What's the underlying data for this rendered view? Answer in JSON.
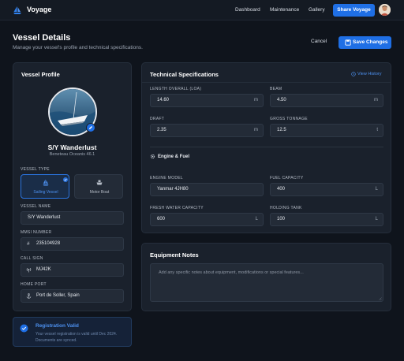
{
  "header": {
    "brand": "Voyage",
    "nav": [
      "Dashboard",
      "Maintenance",
      "Gallery"
    ],
    "share_label": "Share Voyage"
  },
  "page": {
    "title": "Vessel Details",
    "subtitle": "Manage your vessel's profile and technical specifications.",
    "cancel_label": "Cancel",
    "save_label": "Save Changes"
  },
  "profile": {
    "card_title": "Vessel Profile",
    "name": "S/Y Wanderlust",
    "model": "Beneteau Oceanis 46.1",
    "vessel_type_label": "VESSEL TYPE",
    "types": [
      {
        "label": "Sailing Vessel",
        "selected": true
      },
      {
        "label": "Motor Boat",
        "selected": false
      }
    ],
    "vessel_name_label": "VESSEL NAME",
    "vessel_name_value": "S/Y Wanderlust",
    "mmsi_label": "MMSI NUMBER",
    "mmsi_value": "235104928",
    "call_sign_label": "CALL SIGN",
    "call_sign_value": "MJ42K",
    "home_port_label": "HOME PORT",
    "home_port_value": "Port de Soller, Spain"
  },
  "registration": {
    "title": "Registration Valid",
    "line1": "Your vessel registration is valid until Dec 2024.",
    "line2": "Documents are synced."
  },
  "specs": {
    "card_title": "Technical Specifications",
    "view_history": "View History",
    "loa_label": "LENGTH OVERALL (LOA)",
    "loa_value": "14.60",
    "loa_unit": "m",
    "beam_label": "BEAM",
    "beam_value": "4.50",
    "beam_unit": "m",
    "draft_label": "DRAFT",
    "draft_value": "2.35",
    "draft_unit": "m",
    "tonnage_label": "GROSS TONNAGE",
    "tonnage_value": "12.5",
    "tonnage_unit": "t",
    "engine_section": "Engine & Fuel",
    "engine_model_label": "ENGINE MODEL",
    "engine_model_value": "Yanmar 4JH80",
    "fuel_label": "FUEL CAPACITY",
    "fuel_value": "400",
    "fuel_unit": "L",
    "water_label": "FRESH WATER CAPACITY",
    "water_value": "600",
    "water_unit": "L",
    "holding_label": "HOLDING TANK",
    "holding_value": "100",
    "holding_unit": "L"
  },
  "notes": {
    "card_title": "Equipment Notes",
    "placeholder": "Add any specific notes about equipment, modifications or special features..."
  },
  "colors": {
    "background": "#0f141c",
    "card": "#1a212c",
    "accent": "#1f6fe5"
  }
}
